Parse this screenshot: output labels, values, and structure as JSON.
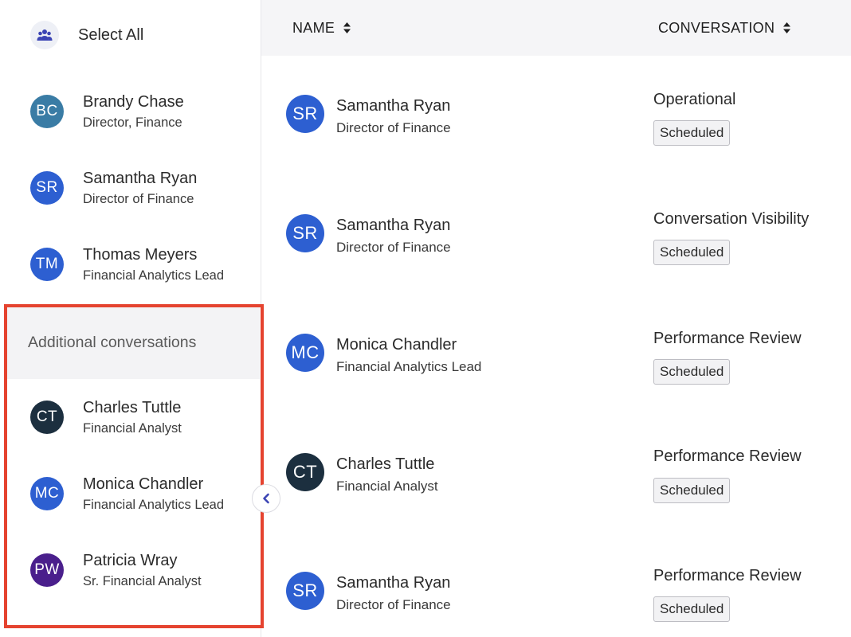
{
  "sidebar": {
    "select_all_label": "Select All",
    "people": [
      {
        "initials": "BC",
        "name": "Brandy Chase",
        "title": "Director, Finance",
        "color": "#3a7ca5"
      },
      {
        "initials": "SR",
        "name": "Samantha Ryan",
        "title": "Director of Finance",
        "color": "#2d5fd1"
      },
      {
        "initials": "TM",
        "name": "Thomas Meyers",
        "title": "Financial Analytics Lead",
        "color": "#2d5fd1"
      }
    ],
    "additional_header": "Additional conversations",
    "additional_people": [
      {
        "initials": "CT",
        "name": "Charles Tuttle",
        "title": "Financial Analyst",
        "color": "#1c2f3f"
      },
      {
        "initials": "MC",
        "name": "Monica Chandler",
        "title": "Financial Analytics Lead",
        "color": "#2d5fd1"
      },
      {
        "initials": "PW",
        "name": "Patricia Wray",
        "title": "Sr. Financial Analyst",
        "color": "#4a1f8c"
      }
    ]
  },
  "table": {
    "headers": {
      "name": "NAME",
      "conversation": "CONVERSATION"
    },
    "rows": [
      {
        "initials": "SR",
        "name": "Samantha Ryan",
        "title": "Director of Finance",
        "conversation": "Operational",
        "status": "Scheduled",
        "color": "#2d5fd1"
      },
      {
        "initials": "SR",
        "name": "Samantha Ryan",
        "title": "Director of Finance",
        "conversation": "Conversation Visibility",
        "status": "Scheduled",
        "color": "#2d5fd1"
      },
      {
        "initials": "MC",
        "name": "Monica Chandler",
        "title": "Financial Analytics Lead",
        "conversation": "Performance Review",
        "status": "Scheduled",
        "color": "#2d5fd1"
      },
      {
        "initials": "CT",
        "name": "Charles Tuttle",
        "title": "Financial Analyst",
        "conversation": "Performance Review",
        "status": "Scheduled",
        "color": "#1c2f3f"
      },
      {
        "initials": "SR",
        "name": "Samantha Ryan",
        "title": "Director of Finance",
        "conversation": "Performance Review",
        "status": "Scheduled",
        "color": "#2d5fd1"
      }
    ]
  },
  "colors": {
    "highlight": "#e5432f",
    "accent": "#2d5fd1"
  }
}
